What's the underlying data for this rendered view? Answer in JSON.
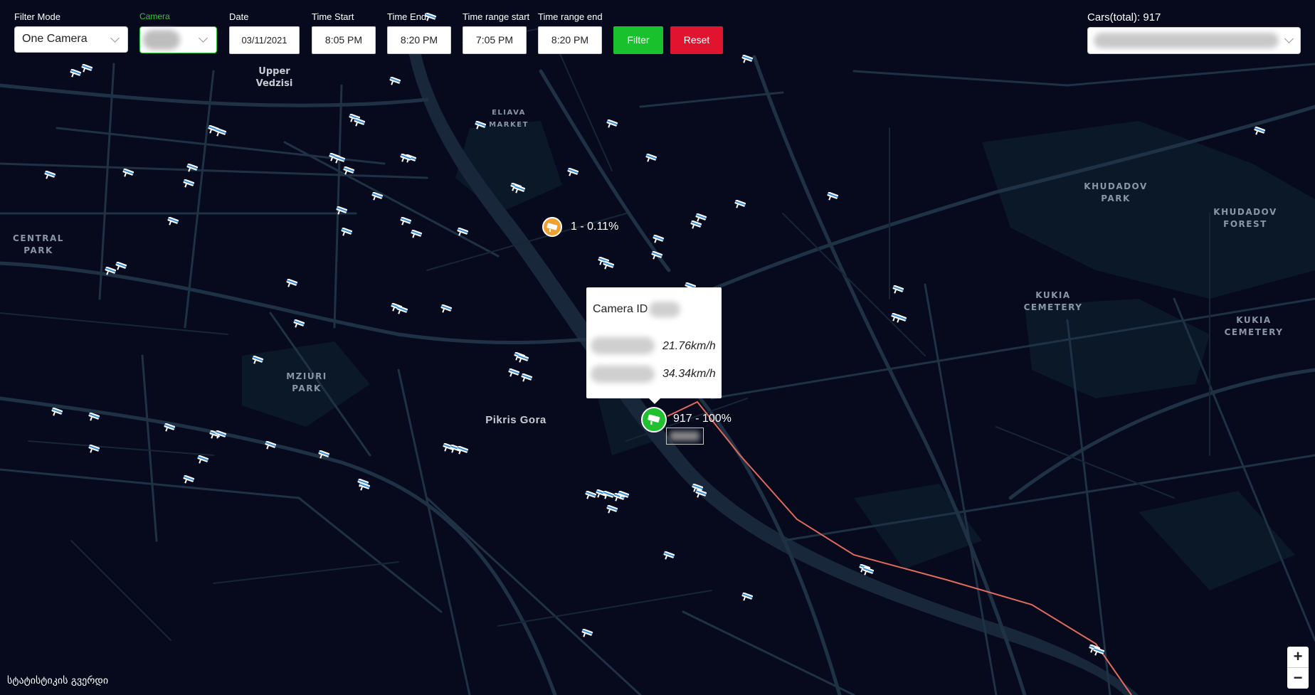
{
  "filters": {
    "filter_mode_label": "Filter Mode",
    "filter_mode_value": "One Camera",
    "camera_label": "Camera",
    "date_label": "Date",
    "date_value": "03/11/2021",
    "time_start_label": "Time Start",
    "time_start_value": "8:05 PM",
    "time_end_label": "Time End",
    "time_end_value": "8:20 PM",
    "range_start_label": "Time range start",
    "range_start_value": "7:05 PM",
    "range_end_label": "Time range end",
    "range_end_value": "8:20 PM",
    "filter_button": "Filter",
    "reset_button": "Reset"
  },
  "cars": {
    "label": "Cars(total): 917"
  },
  "map_labels": {
    "upper_vedzisi": "Upper\nVedzisi",
    "eliava_market": "ELIAVA\nMARKET",
    "central_park": "CENTRAL\nPARK",
    "mziuri_park": "MZIURI\nPARK",
    "pikris_gora": "Pikris Gora",
    "khudadov_park": "KHUDADOV\nPARK",
    "khudadov_forest": "KHUDADOV\nFOREST",
    "kukia_cemetery_1": "KUKIA\nCEMETERY",
    "kukia_cemetery_2": "KUKIA\nCEMETERY"
  },
  "markers": {
    "origin_label": "1 - 0.11%",
    "target_label": "917 - 100%"
  },
  "popup": {
    "title": "Camera ID",
    "speed_1": "21.76km/h",
    "speed_2": "34.34km/h"
  },
  "zoom": {
    "in": "+",
    "out": "−"
  },
  "footer": {
    "stats_link": "სტატისტიკის გვერდი"
  },
  "colors": {
    "map_bg": "#060a1c",
    "road": "#1f3245",
    "river": "#1a2e40",
    "route": "#e06a5e",
    "filter_green": "#19c22c",
    "reset_red": "#e0142e",
    "camera_label_green": "#2ccd3a",
    "origin_orange": "#f0a030",
    "target_green": "#20c030"
  },
  "icons": [
    "camera-icon",
    "chevron-down-icon",
    "plus-icon",
    "minus-icon"
  ]
}
